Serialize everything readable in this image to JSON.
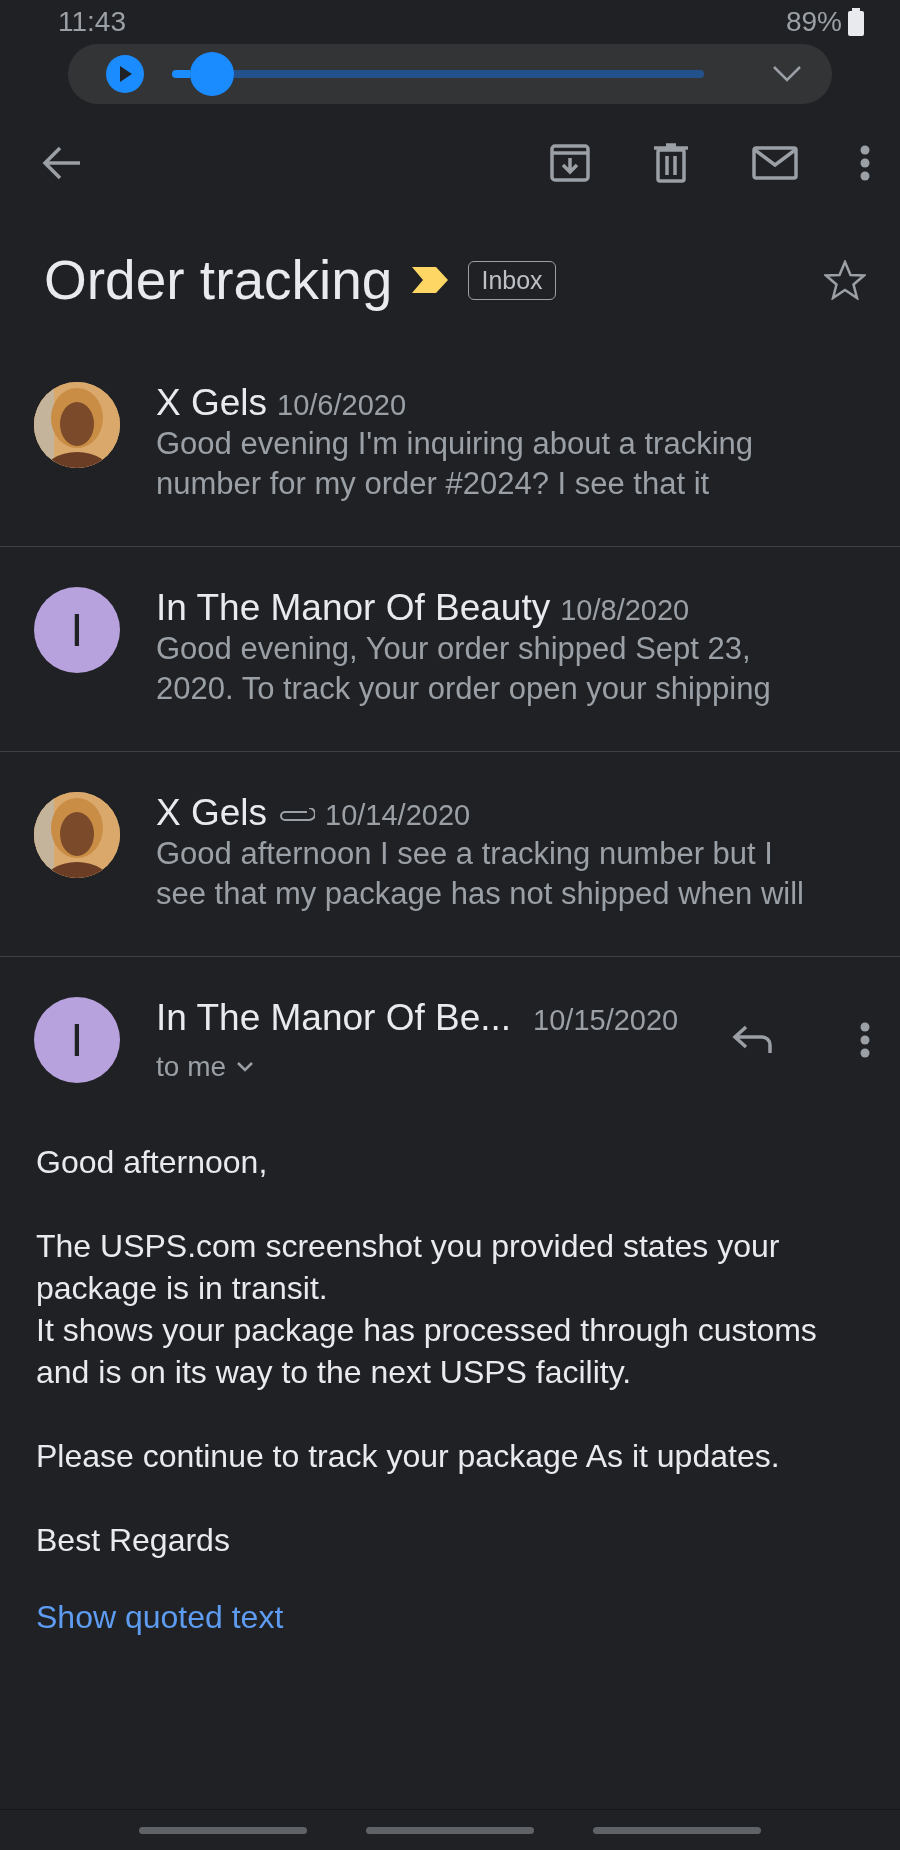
{
  "status_bar": {
    "time": "11:43",
    "battery": "89%"
  },
  "media_player": {
    "playing": false
  },
  "thread": {
    "title": "Order tracking",
    "important": true,
    "label": "Inbox",
    "starred": false
  },
  "messages": [
    {
      "sender": "X Gels",
      "date": "10/6/2020",
      "attachment": false,
      "avatar": {
        "kind": "picture"
      },
      "snippet": [
        "Good evening I'm inquiring about a tracking",
        "number for my order #2024? I see that it"
      ]
    },
    {
      "sender": "In The Manor Of Beauty",
      "date": "10/8/2020",
      "attachment": false,
      "avatar": {
        "kind": "letter",
        "letter": "I",
        "color": "#b7a2de"
      },
      "snippet": [
        "Good evening, Your order shipped Sept 23,",
        "2020. To track your order open your shipping"
      ]
    },
    {
      "sender": "X Gels",
      "date": "10/14/2020",
      "attachment": true,
      "avatar": {
        "kind": "picture"
      },
      "snippet": [
        "Good afternoon I see a tracking number but I",
        "see that my package has not shipped when will"
      ]
    }
  ],
  "open_message": {
    "sender": "In The Manor Of Be...",
    "date": "10/15/2020",
    "avatar": {
      "kind": "letter",
      "letter": "I",
      "color": "#b7a2de"
    },
    "recipient": "to me",
    "body": [
      [
        "Good afternoon,"
      ],
      [
        "The USPS.com screenshot you provided states your package is in transit.",
        "It shows your package has processed through customs and is on its way to the next USPS facility."
      ],
      [
        "Please continue to track your package As it updates."
      ],
      [
        "Best Regards"
      ]
    ],
    "quoted_link": "Show quoted text"
  }
}
